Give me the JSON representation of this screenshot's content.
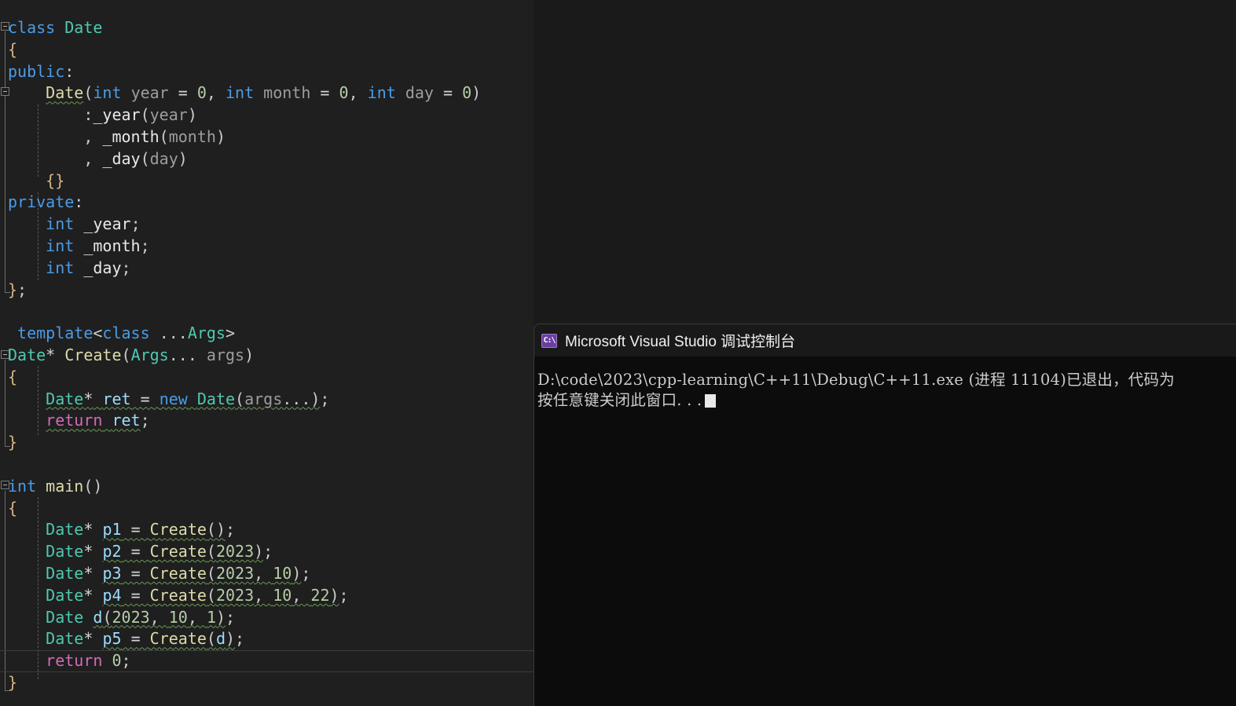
{
  "editor": {
    "name": "code-editor",
    "background": "#1f1f1f",
    "language": "C++",
    "lines": [
      {
        "id": "l1",
        "text": "class Date"
      },
      {
        "id": "l2",
        "text": "{"
      },
      {
        "id": "l3",
        "text": "public:"
      },
      {
        "id": "l4",
        "text": "    Date(int year = 0, int month = 0, int day = 0)"
      },
      {
        "id": "l5",
        "text": "        :_year(year)"
      },
      {
        "id": "l6",
        "text": "        , _month(month)"
      },
      {
        "id": "l7",
        "text": "        , _day(day)"
      },
      {
        "id": "l8",
        "text": "    {}"
      },
      {
        "id": "l9",
        "text": "private:"
      },
      {
        "id": "l10",
        "text": "    int _year;"
      },
      {
        "id": "l11",
        "text": "    int _month;"
      },
      {
        "id": "l12",
        "text": "    int _day;"
      },
      {
        "id": "l13",
        "text": "};"
      },
      {
        "id": "l14",
        "text": ""
      },
      {
        "id": "l15",
        "text": " template<class ...Args>"
      },
      {
        "id": "l16",
        "text": "Date* Create(Args... args)"
      },
      {
        "id": "l17",
        "text": "{"
      },
      {
        "id": "l18",
        "text": "    Date* ret = new Date(args...);"
      },
      {
        "id": "l19",
        "text": "    return ret;"
      },
      {
        "id": "l20",
        "text": "}"
      },
      {
        "id": "l21",
        "text": ""
      },
      {
        "id": "l22",
        "text": "int main()"
      },
      {
        "id": "l23",
        "text": "{"
      },
      {
        "id": "l24",
        "text": "    Date* p1 = Create();"
      },
      {
        "id": "l25",
        "text": "    Date* p2 = Create(2023);"
      },
      {
        "id": "l26",
        "text": "    Date* p3 = Create(2023, 10);"
      },
      {
        "id": "l27",
        "text": "    Date* p4 = Create(2023, 10, 22);"
      },
      {
        "id": "l28",
        "text": "    Date d(2023, 10, 1);"
      },
      {
        "id": "l29",
        "text": "    Date* p5 = Create(d);"
      },
      {
        "id": "l30",
        "text": "    return 0;"
      },
      {
        "id": "l31",
        "text": "}"
      }
    ],
    "tokens": {
      "l1": [
        [
          "kw",
          "class"
        ],
        [
          "plain",
          " "
        ],
        [
          "type",
          "Date"
        ]
      ],
      "l2": [
        [
          "brace",
          "{"
        ]
      ],
      "l3": [
        [
          "kw",
          "public"
        ],
        [
          "punct",
          ":"
        ]
      ],
      "l4": [
        [
          "plain",
          "    "
        ],
        [
          "fn squig",
          "Date"
        ],
        [
          "punct",
          "("
        ],
        [
          "kw",
          "int"
        ],
        [
          "plain",
          " "
        ],
        [
          "param",
          "year"
        ],
        [
          "op",
          " = "
        ],
        [
          "num",
          "0"
        ],
        [
          "punct",
          ", "
        ],
        [
          "kw",
          "int"
        ],
        [
          "plain",
          " "
        ],
        [
          "param",
          "month"
        ],
        [
          "op",
          " = "
        ],
        [
          "num",
          "0"
        ],
        [
          "punct",
          ", "
        ],
        [
          "kw",
          "int"
        ],
        [
          "plain",
          " "
        ],
        [
          "param",
          "day"
        ],
        [
          "op",
          " = "
        ],
        [
          "num",
          "0"
        ],
        [
          "punct",
          ")"
        ]
      ],
      "l5": [
        [
          "plain",
          "        "
        ],
        [
          "punct",
          ":"
        ],
        [
          "mem",
          "_year"
        ],
        [
          "punct",
          "("
        ],
        [
          "param",
          "year"
        ],
        [
          "punct",
          ")"
        ]
      ],
      "l6": [
        [
          "plain",
          "        "
        ],
        [
          "punct",
          ", "
        ],
        [
          "mem",
          "_month"
        ],
        [
          "punct",
          "("
        ],
        [
          "param",
          "month"
        ],
        [
          "punct",
          ")"
        ]
      ],
      "l7": [
        [
          "plain",
          "        "
        ],
        [
          "punct",
          ", "
        ],
        [
          "mem",
          "_day"
        ],
        [
          "punct",
          "("
        ],
        [
          "param",
          "day"
        ],
        [
          "punct",
          ")"
        ]
      ],
      "l8": [
        [
          "plain",
          "    "
        ],
        [
          "brace",
          "{}"
        ]
      ],
      "l9": [
        [
          "kw",
          "private"
        ],
        [
          "punct",
          ":"
        ]
      ],
      "l10": [
        [
          "plain",
          "    "
        ],
        [
          "kw",
          "int"
        ],
        [
          "plain",
          " "
        ],
        [
          "mem",
          "_year"
        ],
        [
          "punct",
          ";"
        ]
      ],
      "l11": [
        [
          "plain",
          "    "
        ],
        [
          "kw",
          "int"
        ],
        [
          "plain",
          " "
        ],
        [
          "mem",
          "_month"
        ],
        [
          "punct",
          ";"
        ]
      ],
      "l12": [
        [
          "plain",
          "    "
        ],
        [
          "kw",
          "int"
        ],
        [
          "plain",
          " "
        ],
        [
          "mem",
          "_day"
        ],
        [
          "punct",
          ";"
        ]
      ],
      "l13": [
        [
          "brace",
          "}"
        ],
        [
          "punct",
          ";"
        ]
      ],
      "l14": [],
      "l15": [
        [
          "plain",
          " "
        ],
        [
          "kw",
          "template"
        ],
        [
          "punct",
          "<"
        ],
        [
          "kw",
          "class"
        ],
        [
          "plain",
          " "
        ],
        [
          "punct",
          "..."
        ],
        [
          "type",
          "Args"
        ],
        [
          "punct",
          ">"
        ]
      ],
      "l16": [
        [
          "type",
          "Date"
        ],
        [
          "op",
          "*"
        ],
        [
          "plain",
          " "
        ],
        [
          "fn",
          "Create"
        ],
        [
          "punct",
          "("
        ],
        [
          "type",
          "Args"
        ],
        [
          "punct",
          "... "
        ],
        [
          "param",
          "args"
        ],
        [
          "punct",
          ")"
        ]
      ],
      "l17": [
        [
          "brace",
          "{"
        ]
      ],
      "l18": [
        [
          "plain",
          "    "
        ],
        [
          "type squig",
          "Date"
        ],
        [
          "op squig",
          "*"
        ],
        [
          "plain squig",
          " "
        ],
        [
          "var squig",
          "ret"
        ],
        [
          "op squig",
          " = "
        ],
        [
          "kw squig",
          "new"
        ],
        [
          "plain squig",
          " "
        ],
        [
          "type squig",
          "Date"
        ],
        [
          "punct squig",
          "("
        ],
        [
          "param squig",
          "args"
        ],
        [
          "punct squig",
          "...)"
        ],
        [
          "punct",
          ";"
        ]
      ],
      "l19": [
        [
          "plain",
          "    "
        ],
        [
          "ctl squig",
          "return"
        ],
        [
          "plain squig",
          " "
        ],
        [
          "var squig",
          "ret"
        ],
        [
          "punct",
          ";"
        ]
      ],
      "l20": [
        [
          "brace",
          "}"
        ]
      ],
      "l21": [],
      "l22": [
        [
          "kw",
          "int"
        ],
        [
          "plain",
          " "
        ],
        [
          "fn",
          "main"
        ],
        [
          "punct",
          "()"
        ]
      ],
      "l23": [
        [
          "brace",
          "{"
        ]
      ],
      "l24": [
        [
          "plain",
          "    "
        ],
        [
          "type",
          "Date"
        ],
        [
          "op",
          "* "
        ],
        [
          "var squig",
          "p1"
        ],
        [
          "op squig",
          " = "
        ],
        [
          "fn squig",
          "Create"
        ],
        [
          "punct squig",
          "()"
        ],
        [
          "punct",
          ";"
        ]
      ],
      "l25": [
        [
          "plain",
          "    "
        ],
        [
          "type",
          "Date"
        ],
        [
          "op",
          "* "
        ],
        [
          "var squig",
          "p2"
        ],
        [
          "op squig",
          " = "
        ],
        [
          "fn squig",
          "Create"
        ],
        [
          "punct squig",
          "("
        ],
        [
          "num squig",
          "2023"
        ],
        [
          "punct squig",
          ")"
        ],
        [
          "punct",
          ";"
        ]
      ],
      "l26": [
        [
          "plain",
          "    "
        ],
        [
          "type",
          "Date"
        ],
        [
          "op",
          "* "
        ],
        [
          "var squig",
          "p3"
        ],
        [
          "op squig",
          " = "
        ],
        [
          "fn squig",
          "Create"
        ],
        [
          "punct squig",
          "("
        ],
        [
          "num squig",
          "2023"
        ],
        [
          "punct squig",
          ", "
        ],
        [
          "num squig",
          "10"
        ],
        [
          "punct squig",
          ")"
        ],
        [
          "punct",
          ";"
        ]
      ],
      "l27": [
        [
          "plain",
          "    "
        ],
        [
          "type",
          "Date"
        ],
        [
          "op",
          "* "
        ],
        [
          "var squig",
          "p4"
        ],
        [
          "op squig",
          " = "
        ],
        [
          "fn squig",
          "Create"
        ],
        [
          "punct squig",
          "("
        ],
        [
          "num squig",
          "2023"
        ],
        [
          "punct squig",
          ", "
        ],
        [
          "num squig",
          "10"
        ],
        [
          "punct squig",
          ", "
        ],
        [
          "num squig",
          "22"
        ],
        [
          "punct squig",
          ")"
        ],
        [
          "punct",
          ";"
        ]
      ],
      "l28": [
        [
          "plain",
          "    "
        ],
        [
          "type",
          "Date"
        ],
        [
          "plain",
          " "
        ],
        [
          "var squig",
          "d"
        ],
        [
          "punct squig",
          "("
        ],
        [
          "num squig",
          "2023"
        ],
        [
          "punct squig",
          ", "
        ],
        [
          "num squig",
          "10"
        ],
        [
          "punct squig",
          ", "
        ],
        [
          "num squig",
          "1"
        ],
        [
          "punct squig",
          ")"
        ],
        [
          "punct",
          ";"
        ]
      ],
      "l29": [
        [
          "plain",
          "    "
        ],
        [
          "type",
          "Date"
        ],
        [
          "op",
          "* "
        ],
        [
          "var squig",
          "p5"
        ],
        [
          "op squig",
          " = "
        ],
        [
          "fn squig",
          "Create"
        ],
        [
          "punct squig",
          "("
        ],
        [
          "var squig",
          "d"
        ],
        [
          "punct squig",
          ")"
        ],
        [
          "punct",
          ";"
        ]
      ],
      "l30": [
        [
          "plain",
          "    "
        ],
        [
          "ctl",
          "return"
        ],
        [
          "plain",
          " "
        ],
        [
          "num",
          "0"
        ],
        [
          "punct",
          ";"
        ]
      ],
      "l31": [
        [
          "brace",
          "}"
        ]
      ]
    },
    "current_line_id": "l30",
    "fold_markers": [
      {
        "line": 0,
        "state": "expanded"
      },
      {
        "line": 3,
        "state": "expanded"
      },
      {
        "line": 15,
        "state": "expanded"
      },
      {
        "line": 21,
        "state": "expanded"
      }
    ]
  },
  "console": {
    "name": "debug-console-window",
    "title": "Microsoft Visual Studio 调试控制台",
    "icon": "console-cmd-icon",
    "icon_label": "C:\\",
    "background": "#0c0c0c",
    "titlebar_background": "#191919",
    "lines": [
      "D:\\code\\2023\\cpp-learning\\C++11\\Debug\\C++11.exe (进程 11104)已退出，代码为",
      "按任意键关闭此窗口. . ."
    ]
  }
}
